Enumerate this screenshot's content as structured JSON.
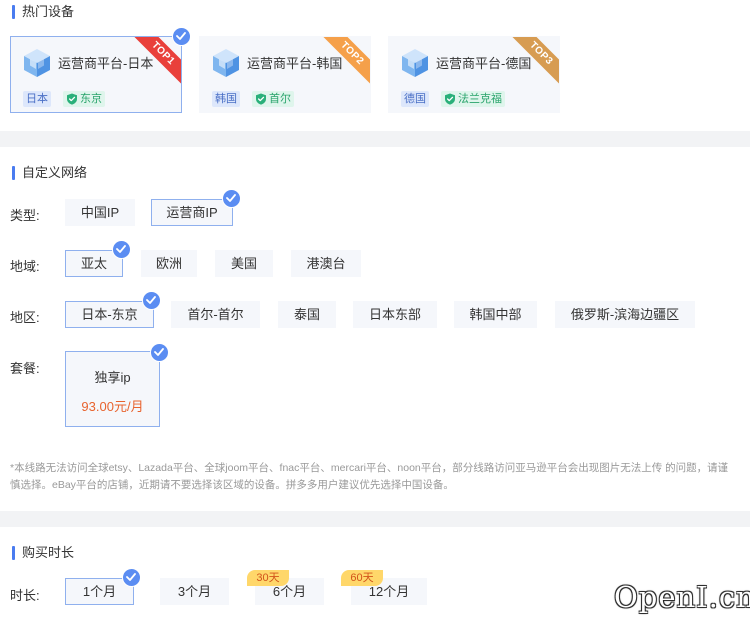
{
  "hot": {
    "title": "热门设备",
    "cards": [
      {
        "name": "运营商平台-日本",
        "country": "日本",
        "city": "东京",
        "rank": "TOP1"
      },
      {
        "name": "运营商平台-韩国",
        "country": "韩国",
        "city": "首尔",
        "rank": "TOP2"
      },
      {
        "name": "运营商平台-德国",
        "country": "德国",
        "city": "法兰克福",
        "rank": "TOP3"
      }
    ]
  },
  "custom": {
    "title": "自定义网络",
    "type_label": "类型:",
    "types": [
      "中国IP",
      "运营商IP"
    ],
    "area_label": "地域:",
    "areas": [
      "亚太",
      "欧洲",
      "美国",
      "港澳台"
    ],
    "region_label": "地区:",
    "regions": [
      "日本-东京",
      "首尔-首尔",
      "泰国",
      "日本东部",
      "韩国中部",
      "俄罗斯-滨海边疆区"
    ],
    "plan_label": "套餐:",
    "plan": {
      "name": "独享ip",
      "price": "93.00元/月"
    },
    "notice": "*本线路无法访问全球etsy、Lazada平台、全球joom平台、fnac平台、mercari平台、noon平台，部分线路访问亚马逊平台会出现图片无法上传 的问题，请谨慎选择。eBay平台的店铺，近期请不要选择该区域的设备。拼多多用户建议优先选择中国设备。"
  },
  "purchase": {
    "title": "购买时长",
    "duration_label": "时长:",
    "options": [
      {
        "label": "1个月",
        "badge": ""
      },
      {
        "label": "3个月",
        "badge": ""
      },
      {
        "label": "6个月",
        "badge": "30天"
      },
      {
        "label": "12个月",
        "badge": "60天"
      }
    ]
  },
  "watermark": "OpenI.cn",
  "colors": {
    "accent": "#5b8df2",
    "price": "#e8632e",
    "top1": "#e9403b",
    "top2": "#f5a04a",
    "top3": "#d79c52"
  }
}
